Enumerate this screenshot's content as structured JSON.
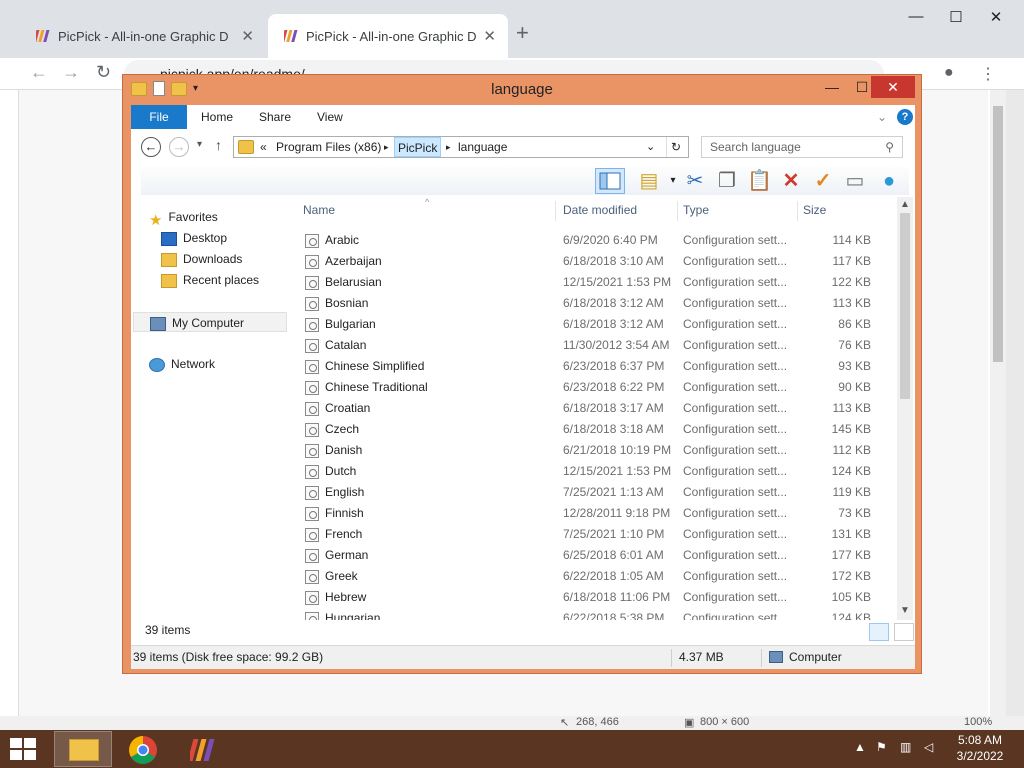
{
  "browser": {
    "tabs": [
      {
        "title": "PicPick - All-in-one Graphic Design",
        "active": false
      },
      {
        "title": "PicPick - All-in-one Graphic Design",
        "active": true
      }
    ],
    "new_tab": "+",
    "address": "picpick.app/en/readme/",
    "window_controls": {
      "minimize": "—",
      "maximize": "☐",
      "close": "✕"
    }
  },
  "picpick_status": {
    "coords": "268, 466",
    "canvas_size": "800 × 600",
    "zoom": "100%"
  },
  "explorer": {
    "title": "language",
    "controls": {
      "minimize": "—",
      "maximize": "☐",
      "close": "✕"
    },
    "ribbon_tabs": [
      "File",
      "Home",
      "Share",
      "View"
    ],
    "breadcrumb": [
      "«",
      "Program Files (x86)",
      "PicPick",
      "language"
    ],
    "search_placeholder": "Search language",
    "nav": {
      "favorites": "Favorites",
      "desktop": "Desktop",
      "downloads": "Downloads",
      "recent": "Recent places",
      "computer": "My Computer",
      "network": "Network"
    },
    "columns": {
      "name": "Name",
      "date": "Date modified",
      "type": "Type",
      "size": "Size"
    },
    "files": [
      {
        "name": "Arabic",
        "date": "6/9/2020 6:40 PM",
        "type": "Configuration sett...",
        "size": "114 KB"
      },
      {
        "name": "Azerbaijan",
        "date": "6/18/2018 3:10 AM",
        "type": "Configuration sett...",
        "size": "117 KB"
      },
      {
        "name": "Belarusian",
        "date": "12/15/2021 1:53 PM",
        "type": "Configuration sett...",
        "size": "122 KB"
      },
      {
        "name": "Bosnian",
        "date": "6/18/2018 3:12 AM",
        "type": "Configuration sett...",
        "size": "113 KB"
      },
      {
        "name": "Bulgarian",
        "date": "6/18/2018 3:12 AM",
        "type": "Configuration sett...",
        "size": "86 KB"
      },
      {
        "name": "Catalan",
        "date": "11/30/2012 3:54 AM",
        "type": "Configuration sett...",
        "size": "76 KB"
      },
      {
        "name": "Chinese Simplified",
        "date": "6/23/2018 6:37 PM",
        "type": "Configuration sett...",
        "size": "93 KB"
      },
      {
        "name": "Chinese Traditional",
        "date": "6/23/2018 6:22 PM",
        "type": "Configuration sett...",
        "size": "90 KB"
      },
      {
        "name": "Croatian",
        "date": "6/18/2018 3:17 AM",
        "type": "Configuration sett...",
        "size": "113 KB"
      },
      {
        "name": "Czech",
        "date": "6/18/2018 3:18 AM",
        "type": "Configuration sett...",
        "size": "145 KB"
      },
      {
        "name": "Danish",
        "date": "6/21/2018 10:19 PM",
        "type": "Configuration sett...",
        "size": "112 KB"
      },
      {
        "name": "Dutch",
        "date": "12/15/2021 1:53 PM",
        "type": "Configuration sett...",
        "size": "124 KB"
      },
      {
        "name": "English",
        "date": "7/25/2021 1:13 AM",
        "type": "Configuration sett...",
        "size": "119 KB"
      },
      {
        "name": "Finnish",
        "date": "12/28/2011 9:18 PM",
        "type": "Configuration sett...",
        "size": "73 KB"
      },
      {
        "name": "French",
        "date": "7/25/2021 1:10 PM",
        "type": "Configuration sett...",
        "size": "131 KB"
      },
      {
        "name": "German",
        "date": "6/25/2018 6:01 AM",
        "type": "Configuration sett...",
        "size": "177 KB"
      },
      {
        "name": "Greek",
        "date": "6/22/2018 1:05 AM",
        "type": "Configuration sett...",
        "size": "172 KB"
      },
      {
        "name": "Hebrew",
        "date": "6/18/2018 11:06 PM",
        "type": "Configuration sett...",
        "size": "105 KB"
      },
      {
        "name": "Hungarian",
        "date": "6/22/2018 5:38 PM",
        "type": "Configuration sett...",
        "size": "124 KB"
      }
    ],
    "item_count": "39 items",
    "status": {
      "left": "39 items (Disk free space: 99.2 GB)",
      "size": "4.37 MB",
      "location": "Computer"
    }
  },
  "taskbar": {
    "time": "5:08 AM",
    "date": "3/2/2022"
  },
  "colors": {
    "explorer_frame": "#ea9466",
    "file_tab": "#1979ca",
    "close_button": "#c7372f",
    "taskbar": "#5a3521"
  }
}
